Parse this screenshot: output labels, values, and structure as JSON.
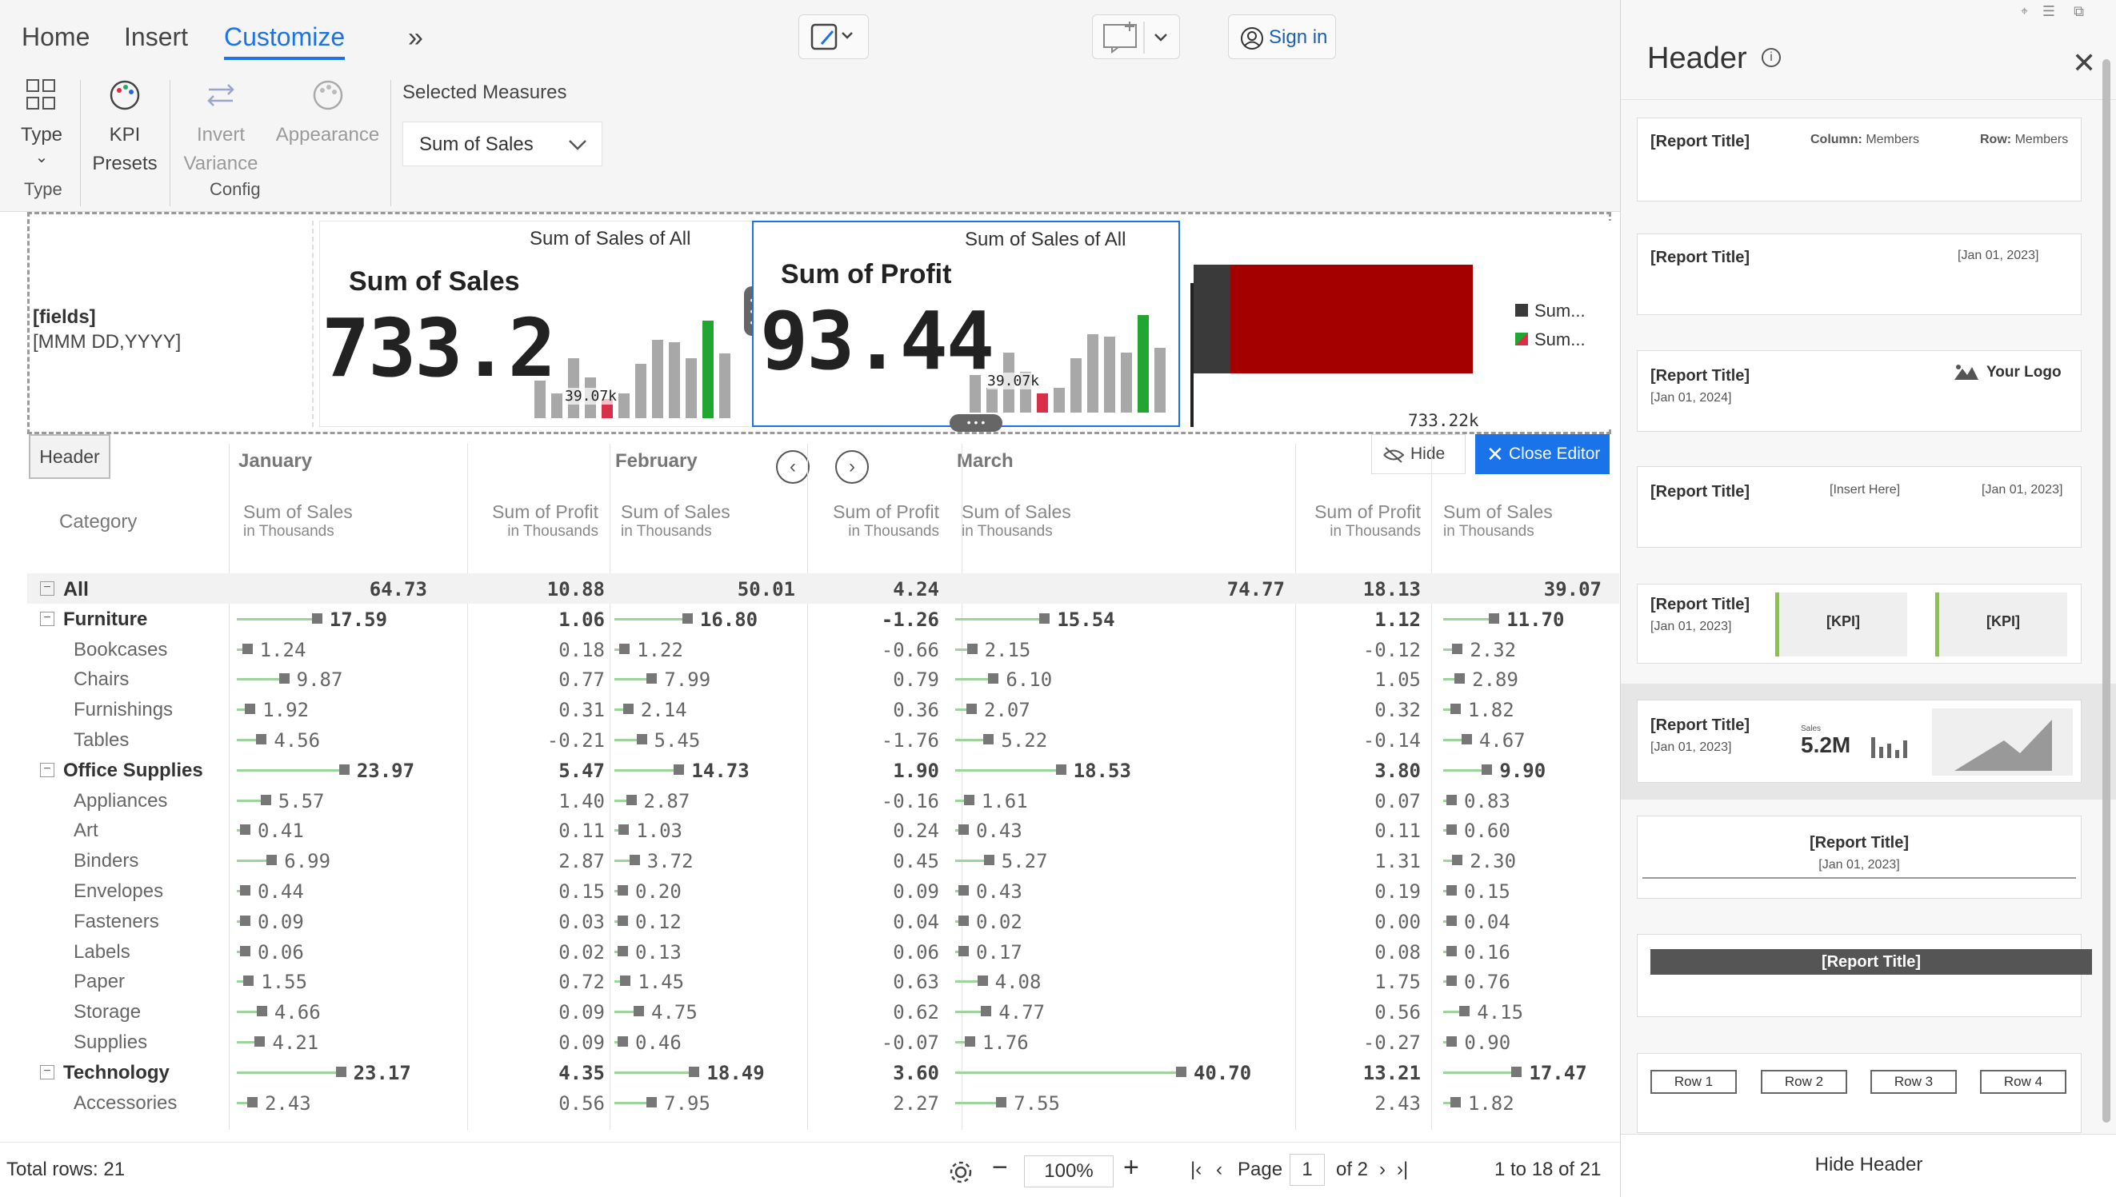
{
  "ribbon": {
    "tabs": [
      "Home",
      "Insert",
      "Customize"
    ],
    "more_glyph": "»",
    "buttons": {
      "type": "Type",
      "kpi_presets_1": "KPI",
      "kpi_presets_2": "Presets",
      "invert_1": "Invert",
      "invert_2": "Variance",
      "appearance": "Appearance"
    },
    "groups": {
      "type": "Type",
      "config": "Config"
    },
    "selected_measures_label": "Selected Measures",
    "selected_measure_value": "Sum of Sales",
    "sign_in": "Sign in"
  },
  "kpi": {
    "fields_label": "[fields]",
    "date_format": "[MMM DD,YYYY]",
    "card1": {
      "caption": "Sum of Sales of All",
      "title": "Sum of Sales",
      "value": "733.2",
      "spark_label": "39.07k"
    },
    "card2": {
      "caption": "Sum of Sales of All",
      "title": "Sum of Profit",
      "value": "93.44",
      "spark_label": "39.07k"
    },
    "card3": {
      "value_label": "733.22k",
      "legend": [
        "Sum...",
        "Sum..."
      ]
    },
    "spark_values": [
      28,
      18,
      44,
      30,
      14,
      18,
      40,
      58,
      56,
      44,
      72,
      48
    ],
    "hide": "Hide",
    "close_editor": "Close Editor",
    "colors": {
      "accent": "#1a73e8",
      "green": "#21a631",
      "red": "#d9304a",
      "dark_red": "#a50000"
    }
  },
  "grid": {
    "header_tag": "Header",
    "months": [
      "January",
      "February",
      "March"
    ],
    "category_header": "Category",
    "col_main": "Sum of Sales",
    "col_profit": "Sum of Profit",
    "col_sub": "in Thousands",
    "rows": [
      {
        "name": "All",
        "level": 0,
        "expand": true,
        "all": true,
        "v": [
          "64.73",
          "10.88",
          "50.01",
          "4.24",
          "74.77",
          "18.13",
          "39.07"
        ]
      },
      {
        "name": "Furniture",
        "level": 0,
        "expand": true,
        "v": [
          "17.59",
          "1.06",
          "16.80",
          "-1.26",
          "15.54",
          "1.12",
          "11.70"
        ]
      },
      {
        "name": "Bookcases",
        "level": 1,
        "v": [
          "1.24",
          "0.18",
          "1.22",
          "-0.66",
          "2.15",
          "-0.12",
          "2.32"
        ]
      },
      {
        "name": "Chairs",
        "level": 1,
        "v": [
          "9.87",
          "0.77",
          "7.99",
          "0.79",
          "6.10",
          "1.05",
          "2.89"
        ]
      },
      {
        "name": "Furnishings",
        "level": 1,
        "v": [
          "1.92",
          "0.31",
          "2.14",
          "0.36",
          "2.07",
          "0.32",
          "1.82"
        ]
      },
      {
        "name": "Tables",
        "level": 1,
        "v": [
          "4.56",
          "-0.21",
          "5.45",
          "-1.76",
          "5.22",
          "-0.14",
          "4.67"
        ]
      },
      {
        "name": "Office Supplies",
        "level": 0,
        "expand": true,
        "v": [
          "23.97",
          "5.47",
          "14.73",
          "1.90",
          "18.53",
          "3.80",
          "9.90"
        ]
      },
      {
        "name": "Appliances",
        "level": 1,
        "v": [
          "5.57",
          "1.40",
          "2.87",
          "-0.16",
          "1.61",
          "0.07",
          "0.83"
        ]
      },
      {
        "name": "Art",
        "level": 1,
        "v": [
          "0.41",
          "0.11",
          "1.03",
          "0.24",
          "0.43",
          "0.11",
          "0.60"
        ]
      },
      {
        "name": "Binders",
        "level": 1,
        "v": [
          "6.99",
          "2.87",
          "3.72",
          "0.45",
          "5.27",
          "1.31",
          "2.30"
        ]
      },
      {
        "name": "Envelopes",
        "level": 1,
        "v": [
          "0.44",
          "0.15",
          "0.20",
          "0.09",
          "0.43",
          "0.19",
          "0.15"
        ]
      },
      {
        "name": "Fasteners",
        "level": 1,
        "v": [
          "0.09",
          "0.03",
          "0.12",
          "0.04",
          "0.02",
          "0.00",
          "0.04"
        ]
      },
      {
        "name": "Labels",
        "level": 1,
        "v": [
          "0.06",
          "0.02",
          "0.13",
          "0.06",
          "0.17",
          "0.08",
          "0.16"
        ]
      },
      {
        "name": "Paper",
        "level": 1,
        "v": [
          "1.55",
          "0.72",
          "1.45",
          "0.63",
          "4.08",
          "1.75",
          "0.76"
        ]
      },
      {
        "name": "Storage",
        "level": 1,
        "v": [
          "4.66",
          "0.09",
          "4.75",
          "0.62",
          "4.77",
          "0.56",
          "4.15"
        ]
      },
      {
        "name": "Supplies",
        "level": 1,
        "v": [
          "4.21",
          "0.09",
          "0.46",
          "-0.07",
          "1.76",
          "-0.27",
          "0.90"
        ]
      },
      {
        "name": "Technology",
        "level": 0,
        "expand": true,
        "v": [
          "23.17",
          "4.35",
          "18.49",
          "3.60",
          "40.70",
          "13.21",
          "17.47"
        ]
      },
      {
        "name": "Accessories",
        "level": 1,
        "v": [
          "2.43",
          "0.56",
          "7.95",
          "2.27",
          "7.55",
          "2.43",
          "1.82"
        ]
      }
    ]
  },
  "panel": {
    "title": "Header",
    "thumbs": {
      "report_title": "[Report Title]",
      "column_label": "Column:",
      "column_value": "Members",
      "row_label": "Row:",
      "row_value": "Members",
      "date_2023": "[Jan 01, 2023]",
      "date_2024": "[Jan 01, 2024]",
      "your_logo": "Your Logo",
      "insert_here": "[Insert Here]",
      "kpi": "[KPI]",
      "sales_small": "Sales",
      "sales_value": "5.2M",
      "rows": [
        "Row 1",
        "Row 2",
        "Row 3",
        "Row 4"
      ]
    },
    "hide_header": "Hide Header"
  },
  "status": {
    "total_rows": "Total rows: 21",
    "zoom": "100%",
    "page_label": "Page",
    "page_value": "1",
    "page_of": "of 2",
    "range": "1 to 18 of 21"
  }
}
